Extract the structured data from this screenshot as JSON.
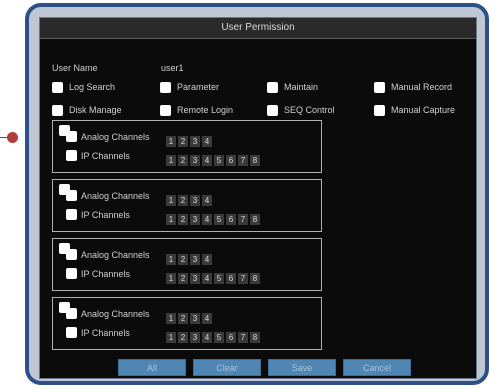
{
  "dialog": {
    "title": "User Permission",
    "user_label": "User Name",
    "user_value": "user1"
  },
  "permissions": [
    {
      "label": "Log Search"
    },
    {
      "label": "Parameter"
    },
    {
      "label": "Maintain"
    },
    {
      "label": "Manual Record"
    },
    {
      "label": "Disk Manage"
    },
    {
      "label": "Remote Login"
    },
    {
      "label": "SEQ Control"
    },
    {
      "label": "Manual Capture"
    }
  ],
  "channels": {
    "analog_label": "Analog Channels",
    "ip_label": "IP Channels",
    "analog_numbers": [
      "1",
      "2",
      "3",
      "4"
    ],
    "ip_numbers": [
      "1",
      "2",
      "3",
      "4",
      "5",
      "6",
      "7",
      "8"
    ]
  },
  "buttons": {
    "all": "All",
    "clear": "Clear",
    "save": "Save",
    "cancel": "Cancel"
  },
  "colors": {
    "frame_border": "#2f4f8a",
    "frame_bg": "#bfc7d2",
    "dialog_bg": "#0b0b0b",
    "button_bg": "#4f86b3"
  }
}
